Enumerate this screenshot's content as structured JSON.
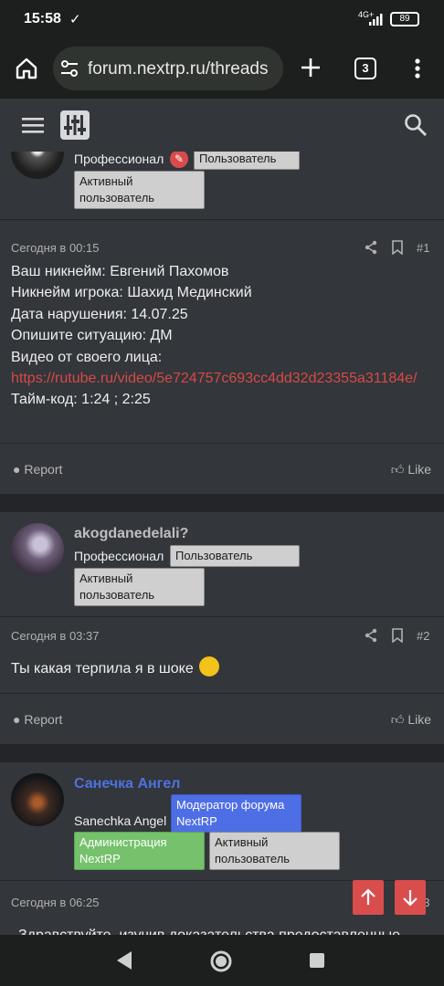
{
  "status": {
    "time": "15:58",
    "network": "4G+",
    "battery": "89"
  },
  "browser": {
    "url": "forum.nextrp.ru/threads",
    "tab_count": "3"
  },
  "posts": [
    {
      "title": "Профессионал",
      "badges": [
        "Пользователь",
        "Активный пользователь"
      ],
      "date": "Сегодня в 00:15",
      "num": "#1",
      "lines": [
        "Ваш никнейм: Евгений Пахомов",
        "Никнейм игрока: Шахид Мединский",
        "Дата нарушения: 14.07.25",
        "Опишите ситуацию: ДМ",
        "Видео от своего лица:"
      ],
      "link": "https://rutube.ru/video/5e724757c693cc4dd32d23355a31184e/",
      "timecode": "Тайм-код: 1:24 ; 2:25",
      "report": "Report",
      "like": "Like"
    },
    {
      "username": "akogdanedelali?",
      "title": "Профессионал",
      "badges": [
        "Пользователь",
        "Активный пользователь"
      ],
      "date": "Сегодня в 03:37",
      "num": "#2",
      "text": "Ты какая терпила я в шоке",
      "report": "Report",
      "like": "Like"
    },
    {
      "username": "Санечка Ангел",
      "title": "Sanechka Angel",
      "badges": [
        "Модератор форума NextRP",
        "Администрация NextRP",
        "Активный пользователь"
      ],
      "date": "Сегодня в 06:25",
      "num": "#3",
      "text": "Здравствуйте, изучив доказательства предоставленные"
    }
  ],
  "colors": {
    "accent_red": "#d64a44",
    "mod_blue": "#4e6ee6",
    "admin_green": "#75c16c"
  }
}
